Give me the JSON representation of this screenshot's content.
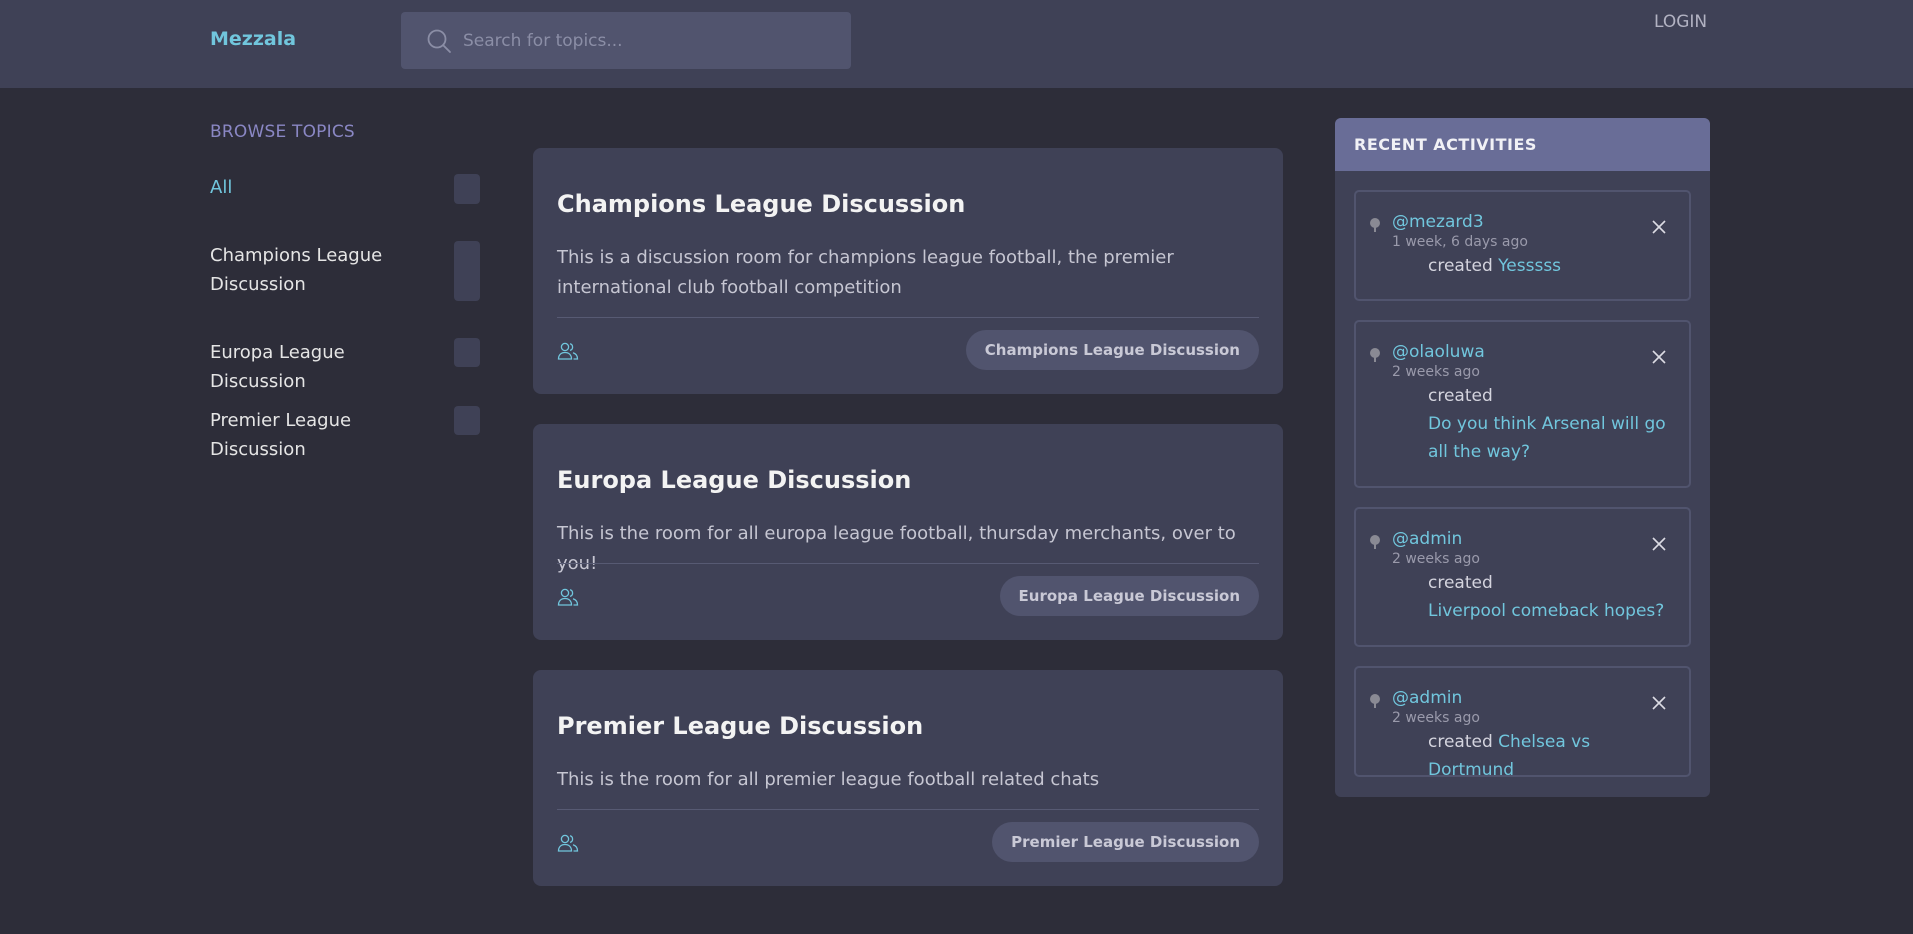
{
  "header": {
    "logo": "Mezzala",
    "search_placeholder": "Search for topics...",
    "login": "LOGIN"
  },
  "browse": {
    "title": "BROWSE TOPICS",
    "topics": [
      {
        "label": "All"
      },
      {
        "label": "Champions League Discussion"
      },
      {
        "label": "Europa League Discussion"
      },
      {
        "label": "Premier League Discussion"
      }
    ]
  },
  "rooms": [
    {
      "title": "Champions League Discussion",
      "description": "This is a discussion room for champions league football, the premier international club football competition",
      "tag": "Champions League Discussion"
    },
    {
      "title": "Europa League Discussion",
      "description": "This is the room for all europa league football, thursday merchants, over to you!",
      "tag": "Europa League Discussion"
    },
    {
      "title": "Premier League Discussion",
      "description": "This is the room for all premier league football related chats",
      "tag": "Premier League Discussion"
    }
  ],
  "activities": {
    "title": "RECENT ACTIVITIES",
    "items": [
      {
        "user": "@mezard3",
        "time": "1 week, 6 days ago",
        "action": "created",
        "target": "Yesssss"
      },
      {
        "user": "@olaoluwa",
        "time": "2 weeks ago",
        "action": "created",
        "target": "Do you think Arsenal will go all the way?"
      },
      {
        "user": "@admin",
        "time": "2 weeks ago",
        "action": "created",
        "target": "Liverpool comeback hopes?"
      },
      {
        "user": "@admin",
        "time": "2 weeks ago",
        "action": "created",
        "target": "Chelsea vs Dortmund"
      }
    ]
  },
  "colors": {
    "background": "#2d2d39",
    "surface": "#3f4156",
    "accent": "#71c6dd",
    "activity_header": "#696d97"
  }
}
